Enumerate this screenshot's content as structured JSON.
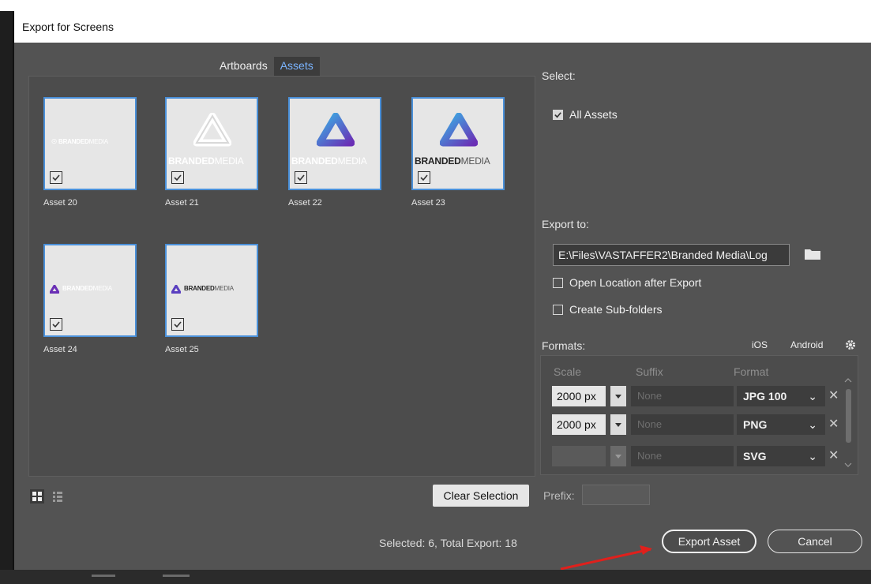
{
  "window": {
    "title": "Export for Screens"
  },
  "tabs": [
    {
      "label": "Artboards"
    },
    {
      "label": "Assets"
    }
  ],
  "assets": [
    {
      "label": "Asset 20"
    },
    {
      "label": "Asset 21"
    },
    {
      "label": "Asset 22"
    },
    {
      "label": "Asset 23"
    },
    {
      "label": "Asset 24"
    },
    {
      "label": "Asset 25"
    }
  ],
  "logo": {
    "bold": "BRANDED",
    "light": "MEDIA"
  },
  "left_footer": {
    "clear_selection": "Clear Selection",
    "status": "Selected: 6, Total Export: 18"
  },
  "select": {
    "label": "Select:",
    "all_assets": "All Assets"
  },
  "export_to": {
    "label": "Export to:",
    "path": "E:\\Files\\VASTAFFER2\\Branded Media\\Log",
    "open_location": "Open Location after Export",
    "create_subfolders": "Create Sub-folders"
  },
  "formats": {
    "label": "Formats:",
    "ios": "iOS",
    "android": "Android",
    "headers": {
      "scale": "Scale",
      "suffix": "Suffix",
      "format": "Format"
    },
    "rows": [
      {
        "scale": "2000 px",
        "suffix": "None",
        "format": "JPG 100"
      },
      {
        "scale": "2000 px",
        "suffix": "None",
        "format": "PNG"
      },
      {
        "scale": "",
        "suffix": "None",
        "format": "SVG"
      }
    ]
  },
  "prefix": {
    "label": "Prefix:"
  },
  "buttons": {
    "export": "Export Asset",
    "cancel": "Cancel"
  },
  "colors": {
    "accent": "#4a90d9",
    "tab_active_text": "#7ab4ff",
    "panel_bg": "#535353",
    "annotation_arrow": "#e0201c"
  }
}
